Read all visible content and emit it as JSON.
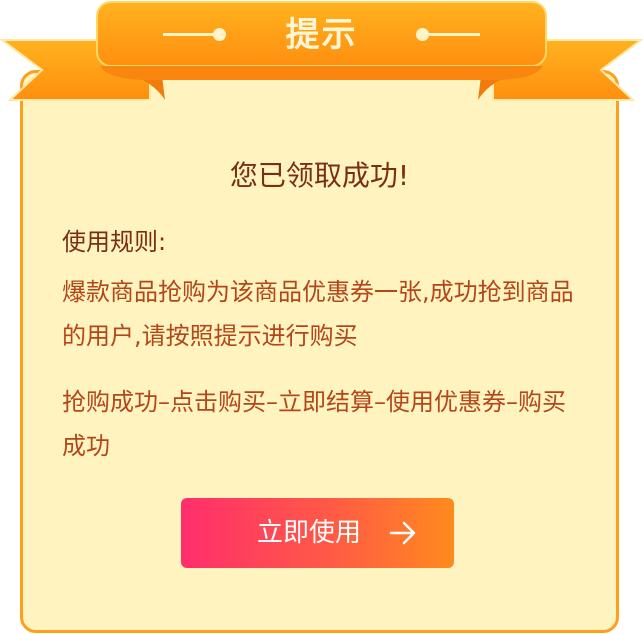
{
  "dialog": {
    "title": "提示",
    "headline": "您已领取成功!",
    "rules_title": "使用规则:",
    "rules_text": "爆款商品抢购为该商品优惠券一张,成功抢到商品的用户,请按照提示进行购买",
    "flow_text": "抢购成功–点击购买–立即结算–使用优惠券–购买成功",
    "button_label": "立即使用",
    "button_icon": "arrow-right-icon"
  },
  "colors": {
    "ribbon": "#ff9f1c",
    "panel_background": "#fff3c0",
    "headline_text": "#7a2f14",
    "rules_text": "#b4471a",
    "button_gradient_start": "#ff2e6d",
    "button_gradient_end": "#ff8a1d"
  }
}
